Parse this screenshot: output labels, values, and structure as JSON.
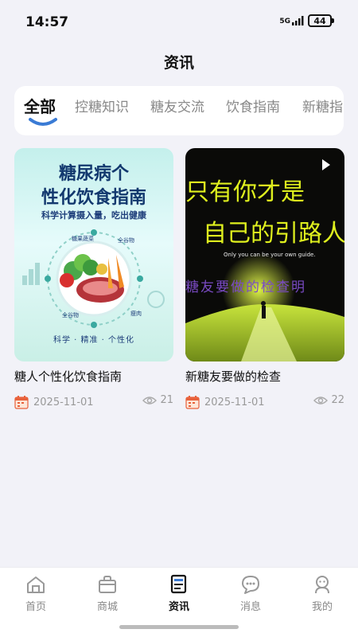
{
  "status": {
    "time": "14:57",
    "signal": "5G",
    "battery": "44"
  },
  "header": {
    "title": "资讯"
  },
  "tabs": [
    {
      "label": "全部",
      "active": true
    },
    {
      "label": "控糖知识",
      "active": false
    },
    {
      "label": "糖友交流",
      "active": false
    },
    {
      "label": "饮食指南",
      "active": false
    },
    {
      "label": "新糖指",
      "active": false
    }
  ],
  "articles": [
    {
      "title": "糖人个性化饮食指南",
      "date": "2025-11-01",
      "views": "21",
      "cover": {
        "headline_1": "糖尿病个",
        "headline_2": "性化饮食指南",
        "subhead": "科学计算摄入量，吃出健康",
        "footer": "科学 · 精准 · 个性化",
        "labels": [
          "糖果蔬菜",
          "全谷物",
          "全谷物",
          "瘦肉"
        ]
      }
    },
    {
      "title": "新糖友要做的检查",
      "date": "2025-11-01",
      "views": "22",
      "cover": {
        "line_1": "只有你才是",
        "line_2": "自己的引路人",
        "english": "Only you can be your own guide.",
        "line_3": "糖友要做的检查明"
      }
    }
  ],
  "bottom_nav": [
    {
      "label": "首页",
      "icon": "home-icon",
      "active": false
    },
    {
      "label": "商城",
      "icon": "shop-bag-icon",
      "active": false
    },
    {
      "label": "资讯",
      "icon": "news-doc-icon",
      "active": true
    },
    {
      "label": "消息",
      "icon": "message-bubble-icon",
      "active": false
    },
    {
      "label": "我的",
      "icon": "profile-icon",
      "active": false
    }
  ],
  "colors": {
    "accent": "#111111",
    "inactive": "#888888",
    "background": "#f2f2f8",
    "tab_indicator": "#3a7bd5"
  }
}
